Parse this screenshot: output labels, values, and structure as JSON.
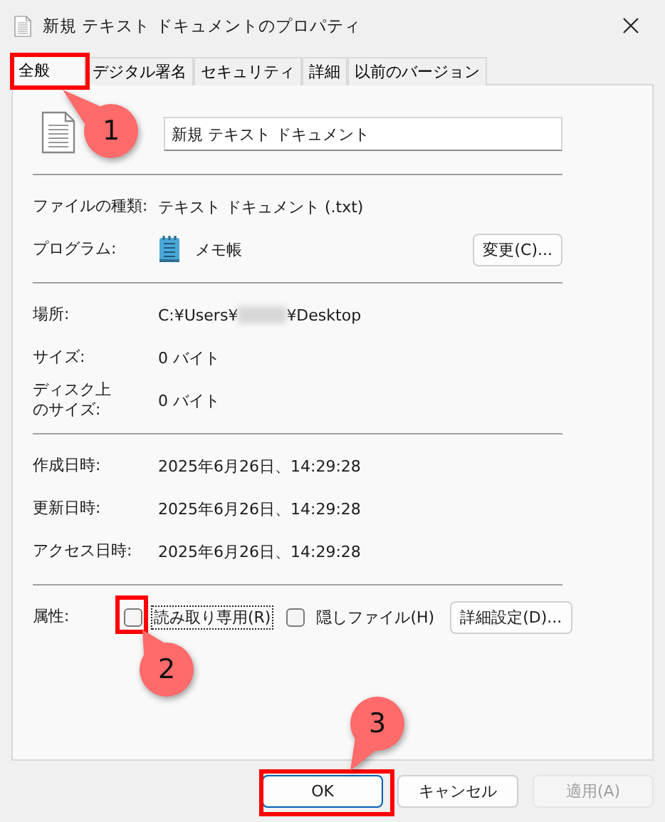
{
  "window": {
    "title": "新規 テキスト ドキュメントのプロパティ"
  },
  "tabs": [
    {
      "label": "全般",
      "selected": true
    },
    {
      "label": "デジタル署名",
      "selected": false
    },
    {
      "label": "セキュリティ",
      "selected": false
    },
    {
      "label": "詳細",
      "selected": false
    },
    {
      "label": "以前のバージョン",
      "selected": false
    }
  ],
  "name_field": {
    "value": "新規 テキスト ドキュメント"
  },
  "sections": [
    [
      {
        "kind": "text",
        "label": "ファイルの種類:",
        "value": "テキスト ドキュメント (.txt)"
      },
      {
        "kind": "program",
        "label": "プログラム:",
        "value": "メモ帳",
        "button": "変更(C)..."
      }
    ],
    [
      {
        "kind": "location",
        "label": "場所:",
        "value_start": "C:¥Users¥",
        "value_end": "¥Desktop",
        "redacted": true
      },
      {
        "kind": "text",
        "label": "サイズ:",
        "value": "0 バイト"
      },
      {
        "kind": "text",
        "label": "ディスク上のサイズ:",
        "value": "0 バイト"
      }
    ],
    [
      {
        "kind": "text",
        "label": "作成日時:",
        "value": "2025年6月26日、14:29:28"
      },
      {
        "kind": "text",
        "label": "更新日時:",
        "value": "2025年6月26日、14:29:28"
      },
      {
        "kind": "text",
        "label": "アクセス日時:",
        "value": "2025年6月26日、14:29:28"
      }
    ],
    [
      {
        "kind": "attributes",
        "label": "属性:",
        "options": [
          {
            "label": "読み取り専用(R)",
            "checked": false,
            "focused": true
          },
          {
            "label": "隠しファイル(H)",
            "checked": false,
            "focused": false
          }
        ],
        "button": "詳細設定(D)..."
      }
    ]
  ],
  "buttons": [
    {
      "label": "OK",
      "default": true,
      "disabled": false
    },
    {
      "label": "キャンセル",
      "default": false,
      "disabled": false
    },
    {
      "label": "適用(A)",
      "default": false,
      "disabled": true
    }
  ],
  "annotations": [
    {
      "label": "1"
    },
    {
      "label": "2"
    },
    {
      "label": "3"
    }
  ]
}
